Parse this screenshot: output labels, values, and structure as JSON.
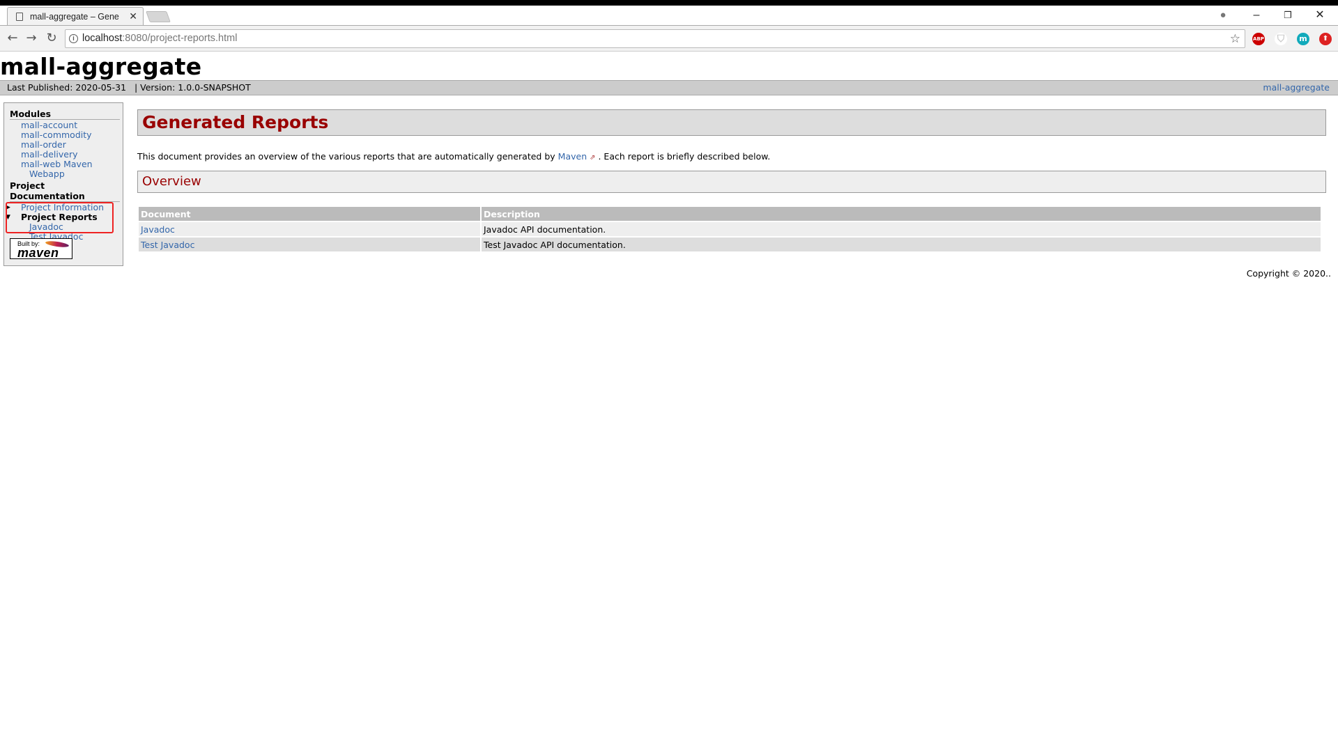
{
  "browser": {
    "tab_title": "mall-aggregate – Gene",
    "url_host": "localhost",
    "url_path": ":8080/project-reports.html",
    "extensions": [
      {
        "name": "adblock-plus",
        "label": "ABP",
        "color": "#c00"
      },
      {
        "name": "shield",
        "label": "",
        "color": "#ddd"
      },
      {
        "name": "m-extension",
        "label": "m",
        "color": "#1ab"
      },
      {
        "name": "upload-extension",
        "label": "⬆",
        "color": "#d22"
      }
    ]
  },
  "site": {
    "banner": "mall-aggregate",
    "last_published": "Last Published: 2020-05-31",
    "version": "| Version: 1.0.0-SNAPSHOT",
    "breadcrumb_right": "mall-aggregate"
  },
  "sidebar": {
    "modules_heading": "Modules",
    "modules": [
      "mall-account",
      "mall-commodity",
      "mall-order",
      "mall-delivery",
      "mall-web Maven",
      "Webapp"
    ],
    "docs_heading": "Project Documentation",
    "project_information": "Project Information",
    "project_reports": "Project Reports",
    "reports": [
      "Javadoc",
      "Test Javadoc"
    ],
    "built_by": "Built by:",
    "maven_logo": "maven"
  },
  "main": {
    "title": "Generated Reports",
    "intro_before": "This document provides an overview of the various reports that are automatically generated by ",
    "intro_link": "Maven",
    "intro_after": " . Each report is briefly described below.",
    "overview": "Overview",
    "table": {
      "headers": [
        "Document",
        "Description"
      ],
      "rows": [
        [
          "Javadoc",
          "Javadoc API documentation."
        ],
        [
          "Test Javadoc",
          "Test Javadoc API documentation."
        ]
      ]
    },
    "copyright": "Copyright © 2020.."
  }
}
